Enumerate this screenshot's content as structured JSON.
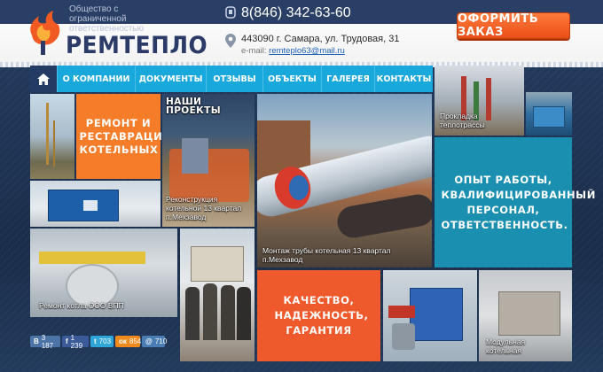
{
  "header": {
    "company_sub": "Общество с ограниченной ответственностью",
    "logo": "РЕМТЕПЛО",
    "phone": "8(846) 342-63-60",
    "address": "443090 г. Самара, ул. Трудовая, 31",
    "email_label": "e-mail:",
    "email": "remteplo63@mail.ru",
    "order_button": "ОФОРМИТЬ ЗАКАЗ"
  },
  "nav": {
    "home_icon": "home-icon",
    "items": [
      "О КОМПАНИИ",
      "ДОКУМЕНТЫ",
      "ОТЗЫВЫ",
      "ОБЪЕКТЫ",
      "ГАЛЕРЕЯ",
      "КОНТАКТЫ"
    ]
  },
  "tiles": {
    "repair_promo": "РЕМОНТ И РЕСТАВРАЦИЯ КОТЕЛЬНЫХ",
    "our_projects": "НАШИ ПРОЕКТЫ",
    "reconstruction_caption": "Реконструкция котельной 13 квартал п.Мехзавод",
    "pipe_caption": "Монтаж трубы котельная 13 квартал п.Мехзавод",
    "heating_caption": "Прокладка теплотрассы",
    "experience_promo": "ОПЫТ РАБОТЫ, КВАЛИФИЦИРОВАННЫЙ ПЕРСОНАЛ, ОТВЕТСТВЕННОСТЬ.",
    "boiler_caption": "Ремонт котла ООО ВПП",
    "quality_promo": "КАЧЕСТВО, НАДЕЖНОСТЬ, ГАРАНТИЯ",
    "modular_caption": "Модульная котельная"
  },
  "social": [
    {
      "label": "В",
      "count": "3 187",
      "color": "#4d74a6"
    },
    {
      "label": "f",
      "count": "1 239",
      "color": "#3b5a9a"
    },
    {
      "label": "t",
      "count": "703",
      "color": "#2fa6d9"
    },
    {
      "label": "ок",
      "count": "854",
      "color": "#f08a1c"
    },
    {
      "label": "@",
      "count": "710",
      "color": "#4a7db4"
    }
  ],
  "colors": {
    "nav_blue": "#19a8dc",
    "orange": "#f57d2a",
    "teal": "#1b8fb0",
    "red_orange": "#ee5a2c",
    "dark_navy": "#2b3a67"
  }
}
